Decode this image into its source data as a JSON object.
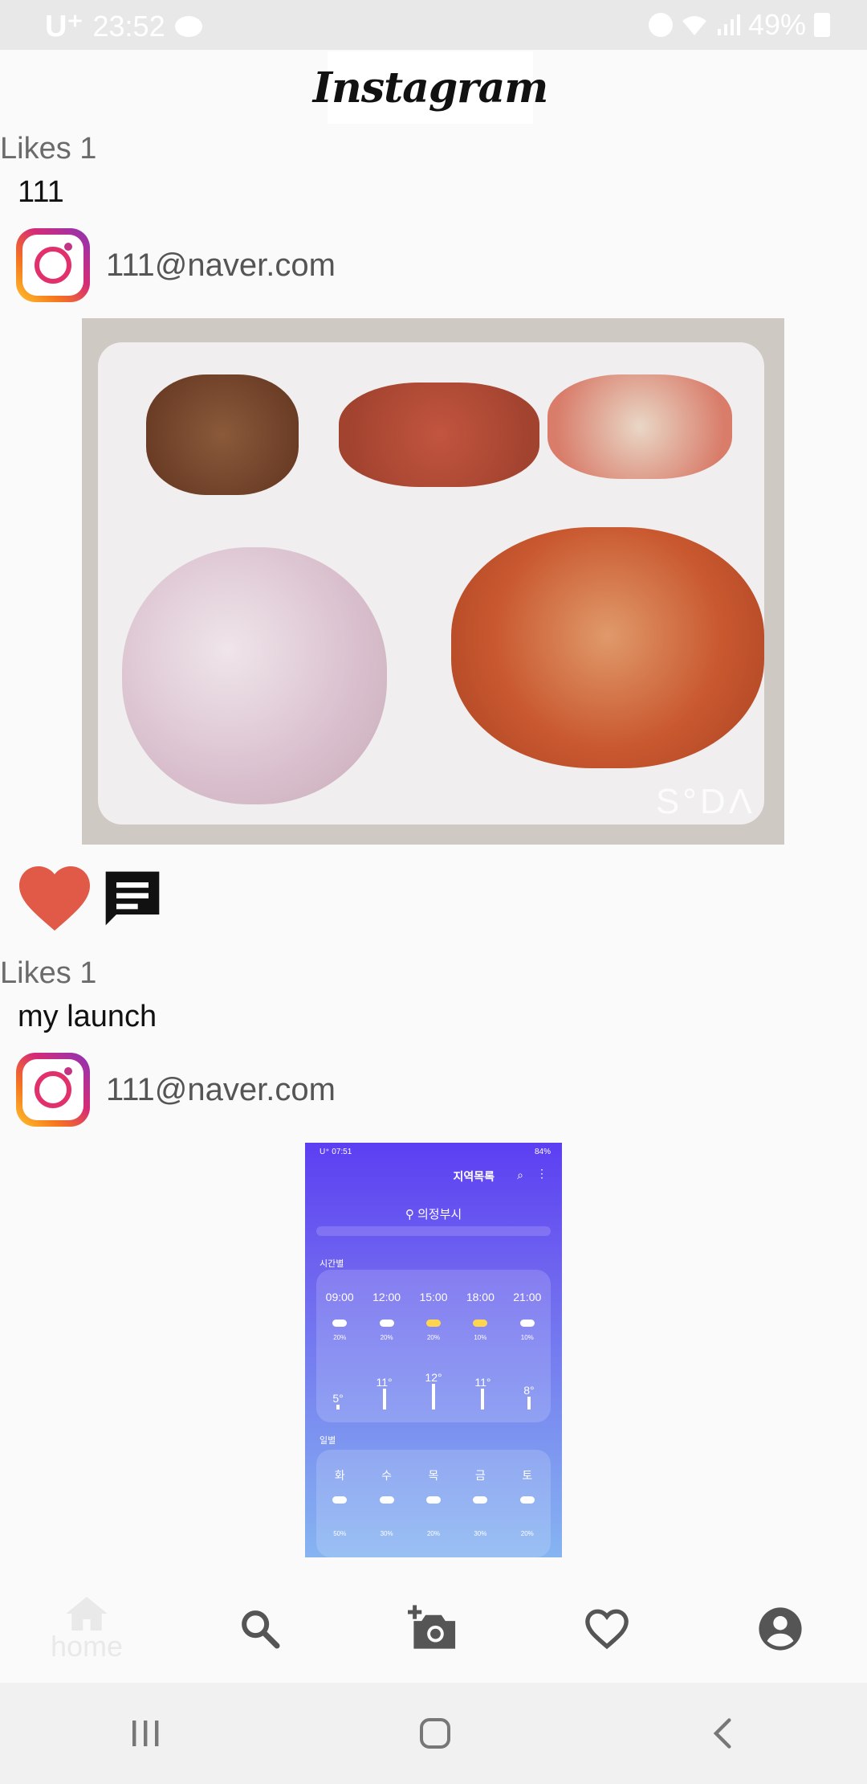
{
  "status_bar": {
    "carrier": "U⁺",
    "time": "23:52",
    "battery": "49%"
  },
  "header": {
    "logo_text": "Instagram"
  },
  "posts": [
    {
      "likes": "Likes 1",
      "caption": "111",
      "user_email": "111@naver.com",
      "image_watermark": "S°DΛ"
    },
    {
      "likes": "Likes 1",
      "caption": "my launch",
      "user_email": "111@naver.com",
      "screenshot": {
        "status_left": "U⁺ 07:51",
        "status_right": "84%",
        "title": "지역목록",
        "location": "의정부시",
        "hourly_label": "시간별",
        "hours": [
          "09:00",
          "12:00",
          "15:00",
          "18:00",
          "21:00"
        ],
        "hour_precip": [
          "20%",
          "20%",
          "20%",
          "10%",
          "10%"
        ],
        "temps": [
          "5°",
          "11°",
          "12°",
          "11°",
          "8°"
        ],
        "daily_label": "일별",
        "days": [
          "화",
          "수",
          "목",
          "금",
          "토"
        ],
        "day_precip": [
          "50%",
          "30%",
          "20%",
          "30%",
          "20%"
        ]
      }
    }
  ],
  "bottom_nav": {
    "home_label": "home"
  }
}
